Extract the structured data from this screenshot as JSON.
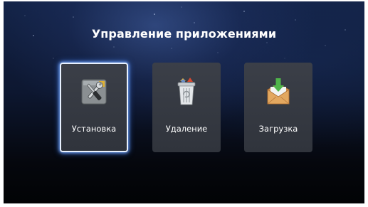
{
  "screen": {
    "title": "Управление приложениями"
  },
  "tiles": [
    {
      "label": "Установка",
      "icon": "tools-icon",
      "selected": true
    },
    {
      "label": "Удаление",
      "icon": "trash-bin-icon",
      "selected": false
    },
    {
      "label": "Загрузка",
      "icon": "download-box-icon",
      "selected": false
    }
  ],
  "colors": {
    "background_top": "#132347",
    "background_bottom": "#020305",
    "tile": "#343841",
    "focus_glow": "#3c78e6"
  }
}
